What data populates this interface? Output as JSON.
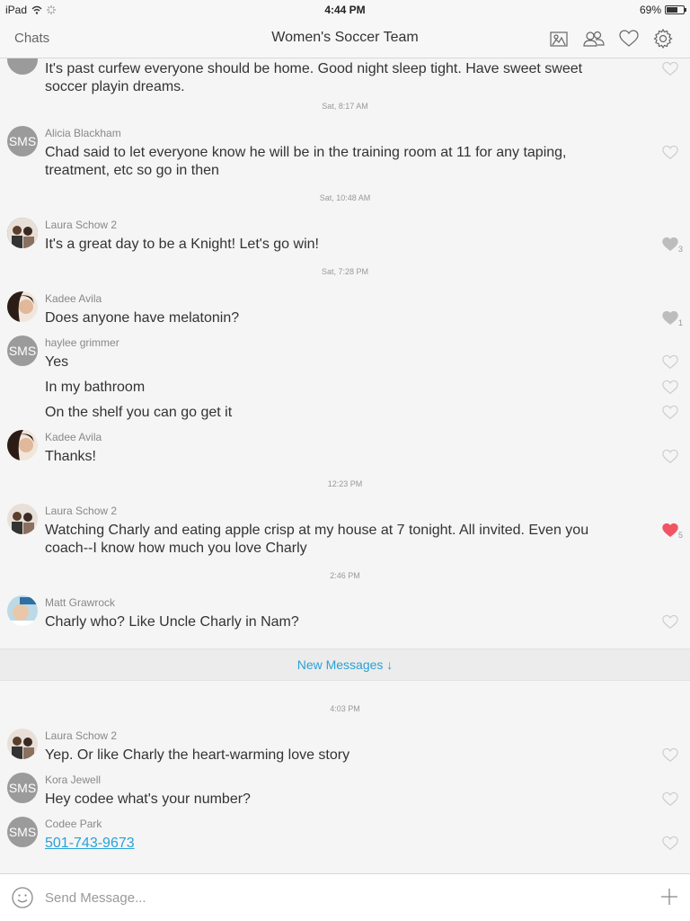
{
  "status_bar": {
    "device": "iPad",
    "time": "4:44 PM",
    "battery_text": "69%",
    "battery_level": 0.69
  },
  "nav": {
    "back_label": "Chats",
    "title": "Women's Soccer Team",
    "icons": [
      "gallery-icon",
      "members-icon",
      "heart-icon",
      "settings-icon"
    ]
  },
  "colors": {
    "accent": "#2aa1d6",
    "liked_heart": "#f05565",
    "sms_avatar": "#9b9b9b"
  },
  "timestamps": [
    "Sat, 8:17 AM",
    "Sat, 10:48 AM",
    "Sat, 7:28 PM",
    "12:23 PM",
    "2:46 PM",
    "4:03 PM"
  ],
  "messages": [
    {
      "sender": "",
      "text": "It's past curfew everyone should be home. Good night sleep tight. Have sweet sweet soccer playin dreams.",
      "likes": ""
    },
    {
      "sender": "Alicia Blackham",
      "avatar": "SMS",
      "text": "Chad said to let everyone know he will be in the training room at 11 for any taping, treatment, etc so go in then",
      "likes": ""
    },
    {
      "sender": "Laura Schow 2",
      "text": "It's a great day to be a Knight! Let's go win!",
      "likes": "3"
    },
    {
      "sender": "Kadee Avila",
      "text": "Does anyone have melatonin?",
      "likes": "1"
    },
    {
      "sender": "haylee grimmer",
      "avatar": "SMS",
      "text": "Yes",
      "likes": ""
    },
    {
      "sender": "",
      "text": "In my bathroom",
      "likes": ""
    },
    {
      "sender": "",
      "text": "On the shelf you can go get it",
      "likes": ""
    },
    {
      "sender": "Kadee Avila",
      "text": "Thanks!",
      "likes": ""
    },
    {
      "sender": "Laura Schow 2",
      "text": "Watching Charly and eating apple crisp at my house at 7 tonight. All invited. Even you coach--I know how much you love Charly",
      "likes": "5"
    },
    {
      "sender": "Matt Grawrock",
      "text": "Charly who? Like Uncle Charly in Nam?",
      "likes": ""
    },
    {
      "sender": "Laura Schow 2",
      "text": "Yep. Or like Charly the heart-warming love story",
      "likes": ""
    },
    {
      "sender": "Kora Jewell",
      "avatar": "SMS",
      "text": "Hey codee what's your number?",
      "likes": ""
    },
    {
      "sender": "Codee Park",
      "avatar": "SMS",
      "text": "501-743-9673",
      "likes": ""
    }
  ],
  "new_messages_label": "New Messages ↓",
  "composer": {
    "placeholder": "Send Message..."
  }
}
